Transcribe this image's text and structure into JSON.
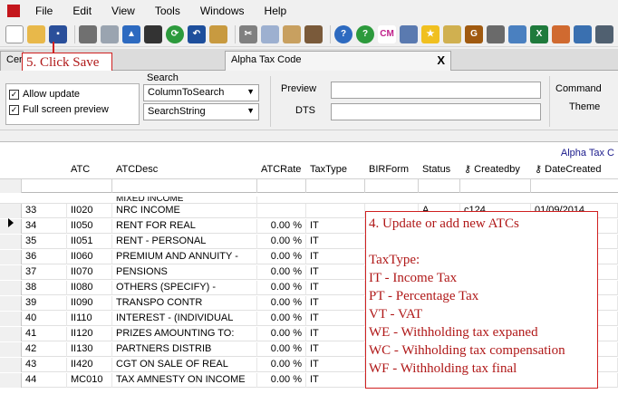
{
  "menu": [
    "File",
    "Edit",
    "View",
    "Tools",
    "Windows",
    "Help"
  ],
  "toolbar_icons": [
    "new-file-icon",
    "open-folder-icon",
    "save-icon",
    "print-icon",
    "print-preview-icon",
    "upload-icon",
    "calculator-icon",
    "refresh-icon",
    "undo-icon",
    "find-icon",
    "cut-icon",
    "copy-icon",
    "paste-icon",
    "grid-icon",
    "help-icon",
    "question-icon",
    "cm-icon",
    "people-icon",
    "star-icon",
    "wand-icon",
    "g-icon",
    "user-key-icon",
    "export-icon",
    "excel-icon",
    "shapes-icon",
    "window-icon",
    "extra-icon"
  ],
  "tabs": {
    "first_partial": "Cent",
    "active_label": "Alpha Tax Code",
    "close": "X"
  },
  "options": {
    "allow_update": "Allow update",
    "full_screen_preview": "Full screen preview"
  },
  "search": {
    "label": "Search",
    "column_value": "ColumnToSearch",
    "string_value": "SearchString"
  },
  "preview": {
    "label": "Preview",
    "dts_label": "DTS"
  },
  "command": {
    "label": "Command",
    "theme_label": "Theme"
  },
  "grid": {
    "title": "Alpha Tax C",
    "columns": [
      "ATC",
      "ATCDesc",
      "ATCRate",
      "TaxType",
      "BIRForm",
      "Status",
      "Createdby",
      "DateCreated"
    ],
    "partial_top": "MIXED INCOME",
    "rows": [
      {
        "no": "33",
        "atc": "II020",
        "desc": "NRC INCOME",
        "rate": "",
        "type": "",
        "form": "",
        "status": "A",
        "by": "c124",
        "date": "01/09/2014"
      },
      {
        "no": "34",
        "atc": "II050",
        "desc": "RENT FOR REAL",
        "rate": "0.00 %",
        "type": "IT",
        "form": "",
        "status": "",
        "by": "",
        "date": ""
      },
      {
        "no": "35",
        "atc": "II051",
        "desc": "RENT - PERSONAL",
        "rate": "0.00 %",
        "type": "IT",
        "form": "",
        "status": "",
        "by": "",
        "date": ""
      },
      {
        "no": "36",
        "atc": "II060",
        "desc": "PREMIUM AND ANNUITY -",
        "rate": "0.00 %",
        "type": "IT",
        "form": "",
        "status": "",
        "by": "",
        "date": ""
      },
      {
        "no": "37",
        "atc": "II070",
        "desc": "PENSIONS",
        "rate": "0.00 %",
        "type": "IT",
        "form": "",
        "status": "",
        "by": "",
        "date": ""
      },
      {
        "no": "38",
        "atc": "II080",
        "desc": "OTHERS (SPECIFY) -",
        "rate": "0.00 %",
        "type": "IT",
        "form": "",
        "status": "",
        "by": "",
        "date": ""
      },
      {
        "no": "39",
        "atc": "II090",
        "desc": "TRANSPO CONTR",
        "rate": "0.00 %",
        "type": "IT",
        "form": "",
        "status": "",
        "by": "",
        "date": ""
      },
      {
        "no": "40",
        "atc": "II110",
        "desc": "INTEREST - (INDIVIDUAL",
        "rate": "0.00 %",
        "type": "IT",
        "form": "",
        "status": "",
        "by": "",
        "date": ""
      },
      {
        "no": "41",
        "atc": "II120",
        "desc": "PRIZES AMOUNTING TO:",
        "rate": "0.00 %",
        "type": "IT",
        "form": "",
        "status": "",
        "by": "",
        "date": ""
      },
      {
        "no": "42",
        "atc": "II130",
        "desc": "PARTNERS DISTRIB",
        "rate": "0.00 %",
        "type": "IT",
        "form": "",
        "status": "",
        "by": "",
        "date": ""
      },
      {
        "no": "43",
        "atc": "II420",
        "desc": "CGT ON SALE OF REAL",
        "rate": "0.00 %",
        "type": "IT",
        "form": "",
        "status": "",
        "by": "",
        "date": ""
      },
      {
        "no": "44",
        "atc": "MC010",
        "desc": "TAX AMNESTY ON INCOME",
        "rate": "0.00 %",
        "type": "IT",
        "form": "",
        "status": "",
        "by": "",
        "date": ""
      }
    ]
  },
  "annotations": {
    "save": "5. Click Save",
    "atc_lines": [
      "4. Update or add new ATCs",
      "",
      "TaxType:",
      "IT - Income Tax",
      "PT - Percentage Tax",
      "VT - VAT",
      "WE - Withholding tax expaned",
      "WC - Wihholding tax compensation",
      "WF - Withholding tax final"
    ]
  },
  "colors": {
    "annotation": "#d02020",
    "title_blue": "#1a1a8c"
  }
}
